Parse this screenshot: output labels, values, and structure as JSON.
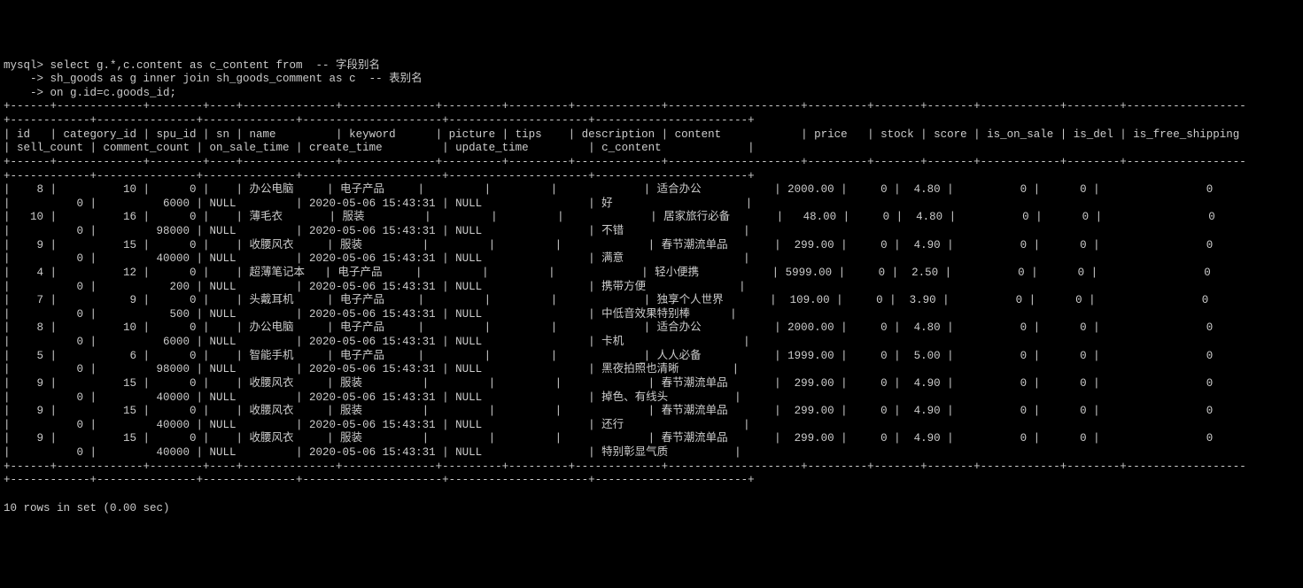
{
  "prompt": "mysql>",
  "cont": "    ->",
  "query_lines": [
    " select g.*,c.content as c_content from  -- 字段别名",
    " sh_goods as g inner join sh_goods_comment as c  -- 表别名",
    " on g.id=c.goods_id;"
  ],
  "border_top": "+------+-------------+--------+----+--------------+--------------+---------+---------+-------------+--------------------+---------+-------+-------+------------+--------+------------------+------------+---------------+--------------+---------------------+---------------------+-----------------------+",
  "header_line1": "| id   | category_id | spu_id | sn | name         | keyword      | picture | tips    | description | content            | price   | stock | score | is_on_sale | is_del | is_free_shipping | sell_count | comment_count | on_sale_time | create_time         | update_time         | c_content             |",
  "border_mid": "+------+-------------+--------+----+--------------+--------------+---------+---------+-------------+--------------------+---------+-------+-------+------------+--------+------------------+------------+---------------+--------------+---------------------+---------------------+-----------------------+",
  "chart_data": {
    "type": "table",
    "columns": [
      "id",
      "category_id",
      "spu_id",
      "sn",
      "name",
      "keyword",
      "picture",
      "tips",
      "description",
      "content",
      "price",
      "stock",
      "score",
      "is_on_sale",
      "is_del",
      "is_free_shipping",
      "sell_count",
      "comment_count",
      "on_sale_time",
      "create_time",
      "update_time",
      "c_content"
    ],
    "rows": [
      {
        "id": 8,
        "category_id": 10,
        "spu_id": 0,
        "sn": "",
        "name": "办公电脑",
        "keyword": "电子产品",
        "picture": "",
        "tips": "",
        "description": "",
        "content": "适合办公",
        "price": "2000.00",
        "stock": 0,
        "score": "4.80",
        "is_on_sale": 0,
        "is_del": 0,
        "is_free_shipping": 0,
        "sell_count": 0,
        "comment_count": 6000,
        "on_sale_time": "NULL",
        "create_time": "2020-05-06 15:43:31",
        "update_time": "NULL",
        "c_content": "好"
      },
      {
        "id": 10,
        "category_id": 16,
        "spu_id": 0,
        "sn": "",
        "name": "薄毛衣",
        "keyword": "服装",
        "picture": "",
        "tips": "",
        "description": "",
        "content": "居家旅行必备",
        "price": "48.00",
        "stock": 0,
        "score": "4.80",
        "is_on_sale": 0,
        "is_del": 0,
        "is_free_shipping": 0,
        "sell_count": 0,
        "comment_count": 98000,
        "on_sale_time": "NULL",
        "create_time": "2020-05-06 15:43:31",
        "update_time": "NULL",
        "c_content": "不错"
      },
      {
        "id": 9,
        "category_id": 15,
        "spu_id": 0,
        "sn": "",
        "name": "收腰风衣",
        "keyword": "服装",
        "picture": "",
        "tips": "",
        "description": "",
        "content": "春节潮流单品",
        "price": "299.00",
        "stock": 0,
        "score": "4.90",
        "is_on_sale": 0,
        "is_del": 0,
        "is_free_shipping": 0,
        "sell_count": 0,
        "comment_count": 40000,
        "on_sale_time": "NULL",
        "create_time": "2020-05-06 15:43:31",
        "update_time": "NULL",
        "c_content": "满意"
      },
      {
        "id": 4,
        "category_id": 12,
        "spu_id": 0,
        "sn": "",
        "name": "超薄笔记本",
        "keyword": "电子产品",
        "picture": "",
        "tips": "",
        "description": "",
        "content": "轻小便携",
        "price": "5999.00",
        "stock": 0,
        "score": "2.50",
        "is_on_sale": 0,
        "is_del": 0,
        "is_free_shipping": 0,
        "sell_count": 0,
        "comment_count": 200,
        "on_sale_time": "NULL",
        "create_time": "2020-05-06 15:43:31",
        "update_time": "NULL",
        "c_content": "携带方便"
      },
      {
        "id": 7,
        "category_id": 9,
        "spu_id": 0,
        "sn": "",
        "name": "头戴耳机",
        "keyword": "电子产品",
        "picture": "",
        "tips": "",
        "description": "",
        "content": "独享个人世界",
        "price": "109.00",
        "stock": 0,
        "score": "3.90",
        "is_on_sale": 0,
        "is_del": 0,
        "is_free_shipping": 0,
        "sell_count": 0,
        "comment_count": 500,
        "on_sale_time": "NULL",
        "create_time": "2020-05-06 15:43:31",
        "update_time": "NULL",
        "c_content": "中低音效果特别棒"
      },
      {
        "id": 8,
        "category_id": 10,
        "spu_id": 0,
        "sn": "",
        "name": "办公电脑",
        "keyword": "电子产品",
        "picture": "",
        "tips": "",
        "description": "",
        "content": "适合办公",
        "price": "2000.00",
        "stock": 0,
        "score": "4.80",
        "is_on_sale": 0,
        "is_del": 0,
        "is_free_shipping": 0,
        "sell_count": 0,
        "comment_count": 6000,
        "on_sale_time": "NULL",
        "create_time": "2020-05-06 15:43:31",
        "update_time": "NULL",
        "c_content": "卡机"
      },
      {
        "id": 5,
        "category_id": 6,
        "spu_id": 0,
        "sn": "",
        "name": "智能手机",
        "keyword": "电子产品",
        "picture": "",
        "tips": "",
        "description": "",
        "content": "人人必备",
        "price": "1999.00",
        "stock": 0,
        "score": "5.00",
        "is_on_sale": 0,
        "is_del": 0,
        "is_free_shipping": 0,
        "sell_count": 0,
        "comment_count": 98000,
        "on_sale_time": "NULL",
        "create_time": "2020-05-06 15:43:31",
        "update_time": "NULL",
        "c_content": "黑夜拍照也清晰"
      },
      {
        "id": 9,
        "category_id": 15,
        "spu_id": 0,
        "sn": "",
        "name": "收腰风衣",
        "keyword": "服装",
        "picture": "",
        "tips": "",
        "description": "",
        "content": "春节潮流单品",
        "price": "299.00",
        "stock": 0,
        "score": "4.90",
        "is_on_sale": 0,
        "is_del": 0,
        "is_free_shipping": 0,
        "sell_count": 0,
        "comment_count": 40000,
        "on_sale_time": "NULL",
        "create_time": "2020-05-06 15:43:31",
        "update_time": "NULL",
        "c_content": "掉色、有线头"
      },
      {
        "id": 9,
        "category_id": 15,
        "spu_id": 0,
        "sn": "",
        "name": "收腰风衣",
        "keyword": "服装",
        "picture": "",
        "tips": "",
        "description": "",
        "content": "春节潮流单品",
        "price": "299.00",
        "stock": 0,
        "score": "4.90",
        "is_on_sale": 0,
        "is_del": 0,
        "is_free_shipping": 0,
        "sell_count": 0,
        "comment_count": 40000,
        "on_sale_time": "NULL",
        "create_time": "2020-05-06 15:43:31",
        "update_time": "NULL",
        "c_content": "还行"
      },
      {
        "id": 9,
        "category_id": 15,
        "spu_id": 0,
        "sn": "",
        "name": "收腰风衣",
        "keyword": "服装",
        "picture": "",
        "tips": "",
        "description": "",
        "content": "春节潮流单品",
        "price": "299.00",
        "stock": 0,
        "score": "4.90",
        "is_on_sale": 0,
        "is_del": 0,
        "is_free_shipping": 0,
        "sell_count": 0,
        "comment_count": 40000,
        "on_sale_time": "NULL",
        "create_time": "2020-05-06 15:43:31",
        "update_time": "NULL",
        "c_content": "特别彰显气质"
      }
    ]
  },
  "footer": "10 rows in set (0.00 sec)",
  "widths": {
    "id": 4,
    "category_id": 11,
    "spu_id": 6,
    "sn": 2,
    "name": 12,
    "keyword": 12,
    "picture": 7,
    "tips": 7,
    "description": 11,
    "content": 18,
    "price": 7,
    "stock": 5,
    "score": 5,
    "is_on_sale": 10,
    "is_del": 6,
    "is_free_shipping": 16,
    "sell_count": 10,
    "comment_count": 13,
    "on_sale_time": 12,
    "create_time": 19,
    "update_time": 19,
    "c_content": 21
  },
  "wrap_width": 187
}
